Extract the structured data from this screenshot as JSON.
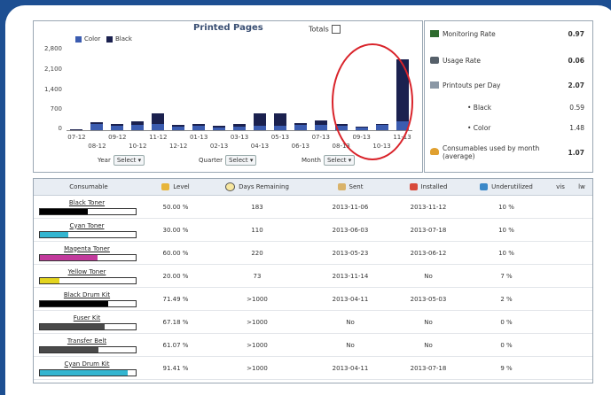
{
  "chart": {
    "title": "Printed Pages",
    "totals_label": "Totals",
    "legend": {
      "color": "Color",
      "black": "Black"
    },
    "controls": {
      "year": "Year",
      "quarter": "Quarter",
      "month": "Month",
      "select": "Select ▾"
    }
  },
  "chart_data": {
    "type": "bar",
    "title": "Printed Pages",
    "categories": [
      "07-12",
      "08-12",
      "09-12",
      "10-12",
      "11-12",
      "12-12",
      "01-13",
      "02-13",
      "03-13",
      "04-13",
      "05-13",
      "06-13",
      "07-13",
      "08-13",
      "09-13",
      "10-13",
      "11-13"
    ],
    "series": [
      {
        "name": "Color",
        "color": "#3b5cb0",
        "values": [
          0,
          220,
          140,
          170,
          200,
          120,
          160,
          100,
          120,
          160,
          150,
          170,
          180,
          160,
          110,
          180,
          300
        ]
      },
      {
        "name": "Black",
        "color": "#1b214f",
        "values": [
          20,
          40,
          80,
          120,
          360,
          60,
          40,
          60,
          100,
          400,
          420,
          60,
          140,
          40,
          10,
          20,
          2100
        ]
      }
    ],
    "yticks": [
      "2,800",
      "2,100",
      "1,400",
      "700",
      "0"
    ],
    "ylim": [
      0,
      2800
    ]
  },
  "stats": [
    {
      "icon": "monitoring-rate-icon",
      "label": "Monitoring Rate",
      "value": "0.97"
    },
    {
      "icon": "usage-rate-icon",
      "label": "Usage Rate",
      "value": "0.06"
    },
    {
      "icon": "printouts-icon",
      "label": "Printouts per Day",
      "value": "2.07"
    },
    {
      "icon": "",
      "label": "• Black",
      "value": "0.59"
    },
    {
      "icon": "",
      "label": "• Color",
      "value": "1.48"
    },
    {
      "icon": "consumables-icon",
      "label": "Consumables used by month (average)",
      "value": "1.07"
    }
  ],
  "table": {
    "headers": [
      "Consumable",
      "Level",
      "Days Remaining",
      "Sent",
      "Installed",
      "Underutilized",
      "vis",
      "lw"
    ],
    "rows": [
      {
        "name": "Black Toner",
        "level": "50.00 %",
        "fill": 0.5,
        "color": "#000000",
        "days": "183",
        "sent": "2013-11-06",
        "installed": "2013-11-12",
        "under": "10 %"
      },
      {
        "name": "Cyan Toner",
        "level": "30.00 %",
        "fill": 0.3,
        "color": "#33b5d0",
        "days": "110",
        "sent": "2013-06-03",
        "installed": "2013-07-18",
        "under": "10 %"
      },
      {
        "name": "Magenta Toner",
        "level": "60.00 %",
        "fill": 0.6,
        "color": "#c23a9c",
        "days": "220",
        "sent": "2013-05-23",
        "installed": "2013-06-12",
        "under": "10 %"
      },
      {
        "name": "Yellow Toner",
        "level": "20.00 %",
        "fill": 0.2,
        "color": "#e3d41f",
        "days": "73",
        "sent": "2013-11-14",
        "installed": "No",
        "under": "7 %"
      },
      {
        "name": "Black Drum Kit",
        "level": "71.49 %",
        "fill": 0.7149,
        "color": "#000000",
        "days": ">1000",
        "sent": "2013-04-11",
        "installed": "2013-05-03",
        "under": "2 %"
      },
      {
        "name": "Fuser Kit",
        "level": "67.18 %",
        "fill": 0.6718,
        "color": "#4a4a4a",
        "days": ">1000",
        "sent": "No",
        "installed": "No",
        "under": "0 %"
      },
      {
        "name": "Transfer Belt",
        "level": "61.07 %",
        "fill": 0.6107,
        "color": "#4a4a4a",
        "days": ">1000",
        "sent": "No",
        "installed": "No",
        "under": "0 %"
      },
      {
        "name": "Cyan Drum Kit",
        "level": "91.41 %",
        "fill": 0.9141,
        "color": "#33b5d0",
        "days": ">1000",
        "sent": "2013-04-11",
        "installed": "2013-07-18",
        "under": "9 %"
      }
    ]
  }
}
